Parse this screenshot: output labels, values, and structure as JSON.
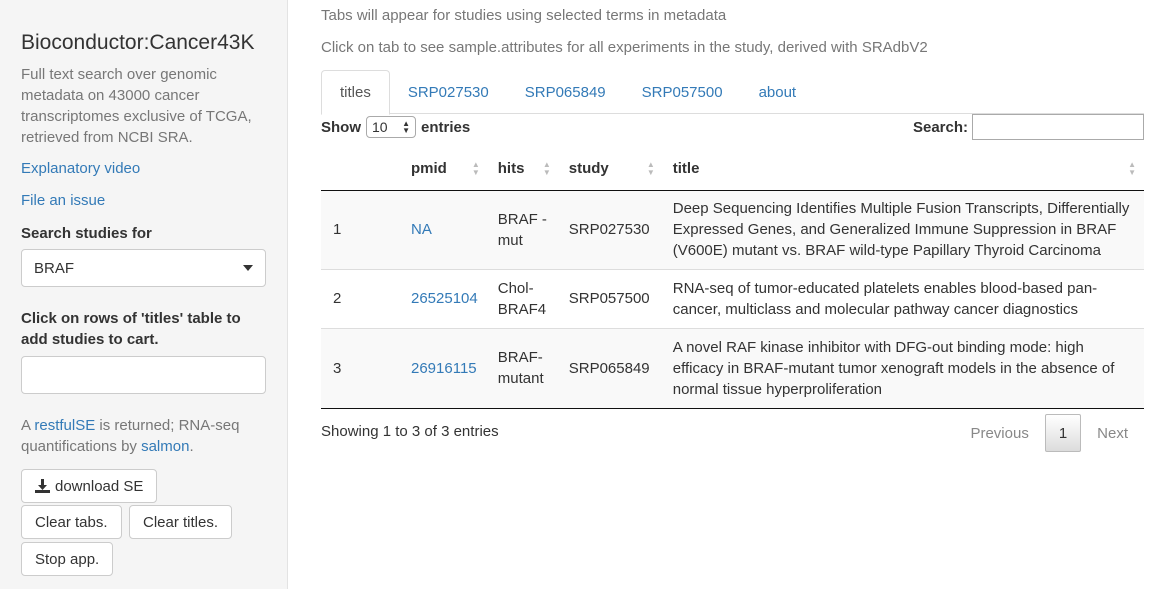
{
  "sidebar": {
    "title": "Bioconductor:Cancer43K",
    "description": "Full text search over genomic metadata on 43000 cancer transcriptomes exclusive of TCGA, retrieved from NCBI SRA.",
    "video_link": "Explanatory video",
    "issue_link": "File an issue",
    "search_label": "Search studies for",
    "search_value": "BRAF",
    "cart_label": "Click on rows of 'titles' table to add studies to cart.",
    "cart_value": "",
    "help_prefix": "A ",
    "help_link1": "restfulSE",
    "help_middle": " is returned; RNA-seq quantifications by ",
    "help_link2": "salmon",
    "help_suffix": ".",
    "download_label": "download SE",
    "clear_tabs_label": "Clear tabs.",
    "clear_titles_label": "Clear titles.",
    "stop_label": "Stop app."
  },
  "main": {
    "line1": "Tabs will appear for studies using selected terms in metadata",
    "line2": "Click on tab to see sample.attributes for all experiments in the study, derived with SRAdbV2",
    "tabs": [
      {
        "label": "titles"
      },
      {
        "label": "SRP027530"
      },
      {
        "label": "SRP065849"
      },
      {
        "label": "SRP057500"
      },
      {
        "label": "about"
      }
    ],
    "show_label": "Show",
    "entries_value": "10",
    "entries_label": "entries",
    "search_label": "Search:",
    "search_value": ""
  },
  "table": {
    "columns": [
      "",
      "pmid",
      "hits",
      "study",
      "title"
    ],
    "rows": [
      {
        "idx": "1",
        "pmid": "NA",
        "hits": "BRAF - mut",
        "study": "SRP027530",
        "title": "Deep Sequencing Identifies Multiple Fusion Transcripts, Differentially Expressed Genes, and Generalized Immune Suppression in BRAF (V600E) mutant vs. BRAF wild-type Papillary Thyroid Carcinoma"
      },
      {
        "idx": "2",
        "pmid": "26525104",
        "hits": "Chol-BRAF4",
        "study": "SRP057500",
        "title": "RNA-seq of tumor-educated platelets enables blood-based pan-cancer, multiclass and molecular pathway cancer diagnostics"
      },
      {
        "idx": "3",
        "pmid": "26916115",
        "hits": "BRAF-mutant",
        "study": "SRP065849",
        "title": "A novel RAF kinase inhibitor with DFG-out binding mode: high efficacy in BRAF-mutant tumor xenograft models in the absence of normal tissue hyperproliferation"
      }
    ],
    "info": "Showing 1 to 3 of 3 entries",
    "previous_label": "Previous",
    "current_page": "1",
    "next_label": "Next"
  }
}
